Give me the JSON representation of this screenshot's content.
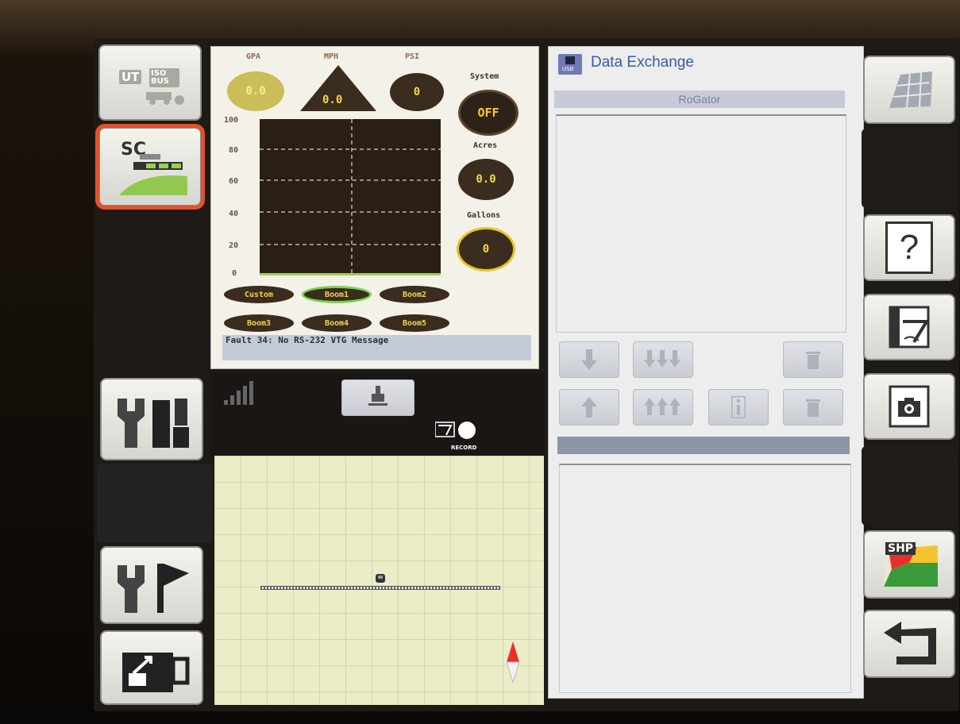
{
  "spray": {
    "gpa_label": "GPA",
    "mph_label": "MPH",
    "psi_label": "PSI",
    "system_label": "System",
    "gpa_value": "0.0",
    "mph_value": "0.0",
    "psi_value": "0",
    "system_state": "OFF",
    "acres_label": "Acres",
    "acres_value": "0.0",
    "gallons_label": "Gallons",
    "gallons_value": "0",
    "chart_ticks": [
      "100",
      "80",
      "60",
      "40",
      "20",
      "0"
    ],
    "booms": [
      {
        "label": "Custom",
        "active": false
      },
      {
        "label": "Boom1",
        "active": true
      },
      {
        "label": "Boom2",
        "active": false
      },
      {
        "label": "Boom3",
        "active": false
      },
      {
        "label": "Boom4",
        "active": false
      },
      {
        "label": "Boom5",
        "active": false
      }
    ],
    "fault": "Fault 34: No RS-232 VTG Message"
  },
  "left_nav": {
    "ut_label": "UT",
    "isobus_label": "ISO BUS",
    "sc_label": "SC"
  },
  "map": {
    "record_label": "RECORD"
  },
  "data_exchange": {
    "usb_label": "USB",
    "title": "Data Exchange",
    "source": "RoGator"
  },
  "right_nav": {
    "help_glyph": "?",
    "shp_label": "SHP"
  },
  "colors": {
    "selected_border": "#e2512a",
    "gauge_value": "#f1d74a",
    "active_boom": "#78d24a",
    "system_off_text": "#ffcc22"
  }
}
